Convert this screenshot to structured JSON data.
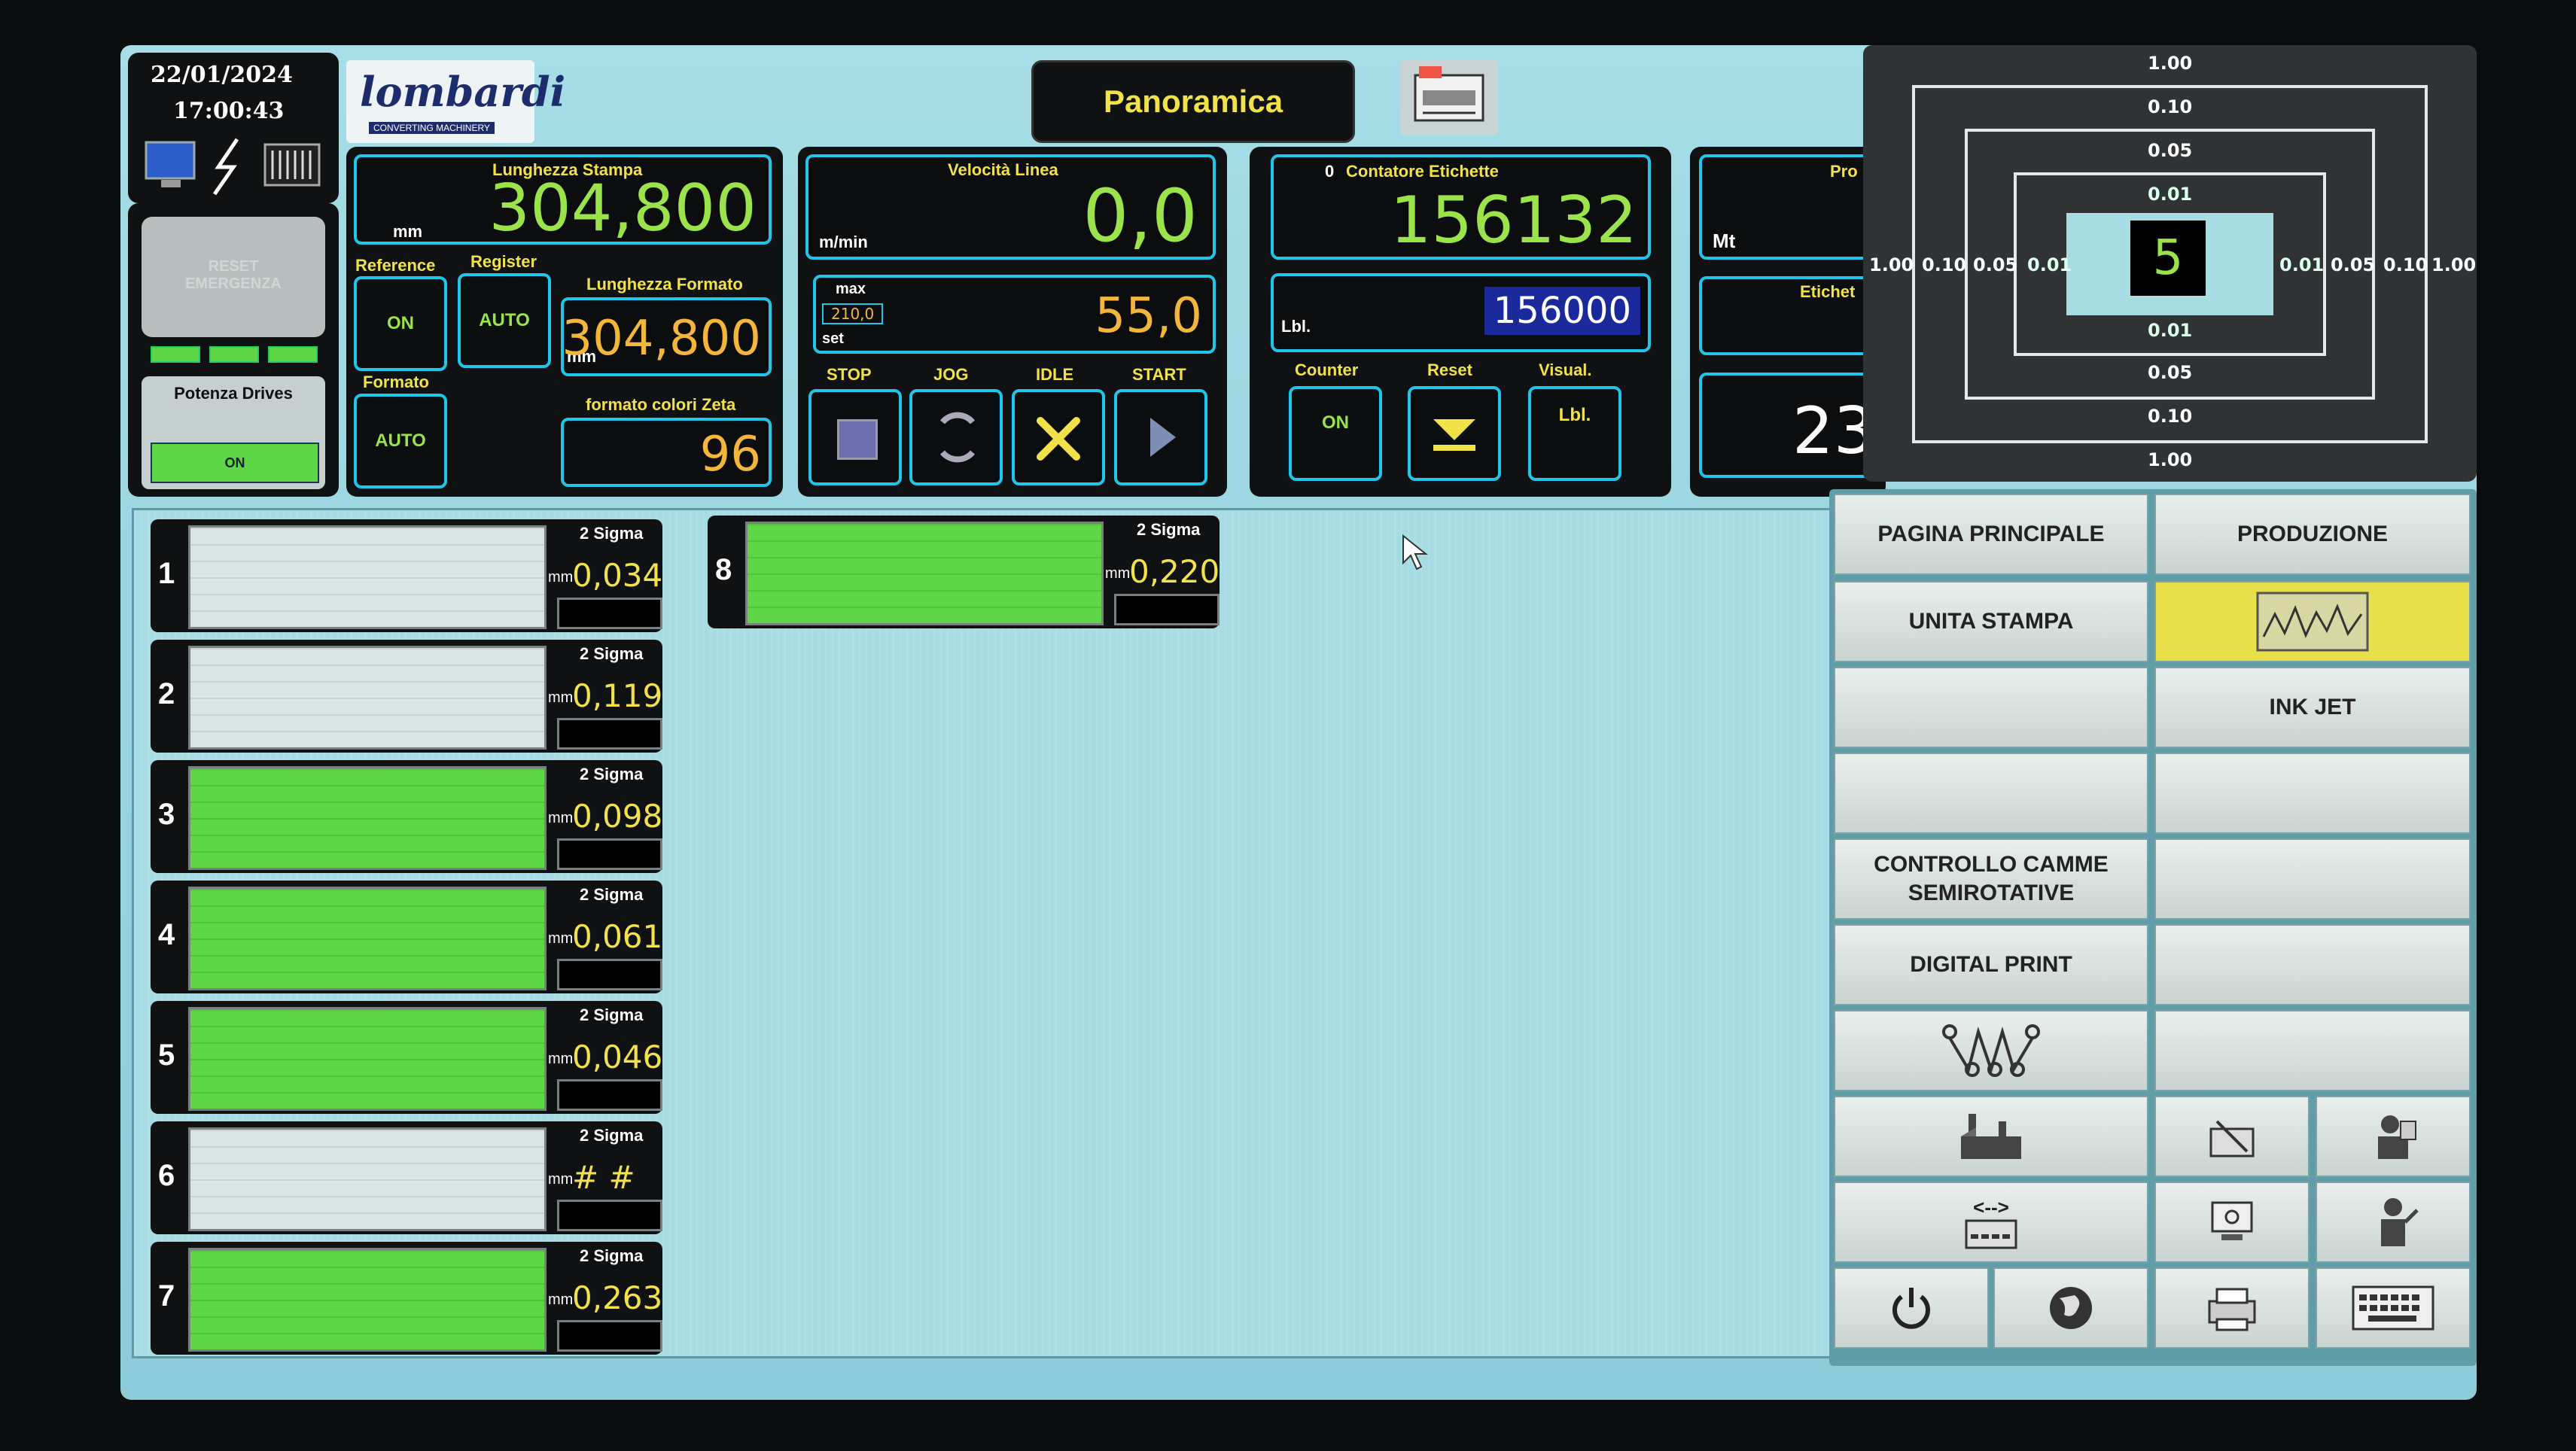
{
  "header": {
    "date": "22/01/2024",
    "time": "17:00:43",
    "logo_text": "lombardi",
    "logo_sub": "CONVERTING MACHINERY",
    "page_title": "Panoramica"
  },
  "left_panel": {
    "reset_label": "RESET EMERGENZA",
    "potenza_drives": "Potenza Drives",
    "potenza_state": "ON"
  },
  "lunghezza": {
    "stampa_label": "Lunghezza Stampa",
    "stampa_unit": "mm",
    "stampa_value": "304,800",
    "reference_label": "Reference",
    "reference_state": "ON",
    "register_label": "Register",
    "register_state": "AUTO",
    "formato_label": "Lunghezza Formato",
    "formato_unit": "mm",
    "formato_value": "304,800",
    "formato_btn_label": "Formato",
    "formato_btn_state": "AUTO",
    "colori_label": "formato colori Zeta",
    "colori_value": "96"
  },
  "velocita": {
    "label": "Velocità Linea",
    "unit": "m/min",
    "value": "0,0",
    "max_label": "max",
    "max_value": "210,0",
    "set_label": "set",
    "set_value": "55,0",
    "stop": "STOP",
    "jog": "JOG",
    "idle": "IDLE",
    "start": "START"
  },
  "contatore": {
    "label": "Contatore Etichette",
    "zero": "0",
    "value": "156132",
    "lbl_label": "Lbl.",
    "target": "156000",
    "counter_label": "Counter",
    "counter_state": "ON",
    "reset_label": "Reset",
    "visual_label": "Visual.",
    "visual_state": "Lbl."
  },
  "partial_panel": {
    "pro_label": "Pro",
    "mt_label": "Mt",
    "etichet_label": "Etichet",
    "partial_value": "23"
  },
  "target_display": {
    "center_value": "5",
    "top": [
      "1.00",
      "0.10",
      "0.05",
      "0.01"
    ],
    "bottom": [
      "0.01",
      "0.05",
      "0.10",
      "1.00"
    ],
    "left": [
      "1.00",
      "0.10",
      "0.05",
      "0.01"
    ],
    "right": [
      "0.01",
      "0.05",
      "0.10",
      "1.00"
    ]
  },
  "gauges": [
    {
      "num": "1",
      "sigma": "2 Sigma",
      "unit": "mm",
      "value": "0,034",
      "level": 0.0
    },
    {
      "num": "2",
      "sigma": "2 Sigma",
      "unit": "mm",
      "value": "0,119",
      "level": 0.0
    },
    {
      "num": "3",
      "sigma": "2 Sigma",
      "unit": "mm",
      "value": "0,098",
      "level": 1.0
    },
    {
      "num": "4",
      "sigma": "2 Sigma",
      "unit": "mm",
      "value": "0,061",
      "level": 1.0
    },
    {
      "num": "5",
      "sigma": "2 Sigma",
      "unit": "mm",
      "value": "0,046",
      "level": 1.0
    },
    {
      "num": "6",
      "sigma": "2 Sigma",
      "unit": "mm",
      "value": "# # # #",
      "level": 0.0
    },
    {
      "num": "7",
      "sigma": "2 Sigma",
      "unit": "mm",
      "value": "0,263",
      "level": 1.0
    },
    {
      "num": "8",
      "sigma": "2 Sigma",
      "unit": "mm",
      "value": "0,220",
      "level": 1.0
    }
  ],
  "menu": {
    "pagina_principale": "PAGINA PRINCIPALE",
    "produzione": "PRODUZIONE",
    "unita_stampa": "UNITA STAMPA",
    "ink_jet": "INK JET",
    "controllo_camme": "CONTROLLO CAMME SEMIROTATIVE",
    "digital_print": "DIGITAL PRINT",
    "arrows_label": "<-->"
  },
  "colors": {
    "accent_cyan": "#1fc6e8",
    "value_green": "#9be34a",
    "value_orange": "#f2b63a",
    "label_yellow": "#f2e24a",
    "bar_green": "#5fd645",
    "highlight_yellow": "#e7e04a"
  }
}
